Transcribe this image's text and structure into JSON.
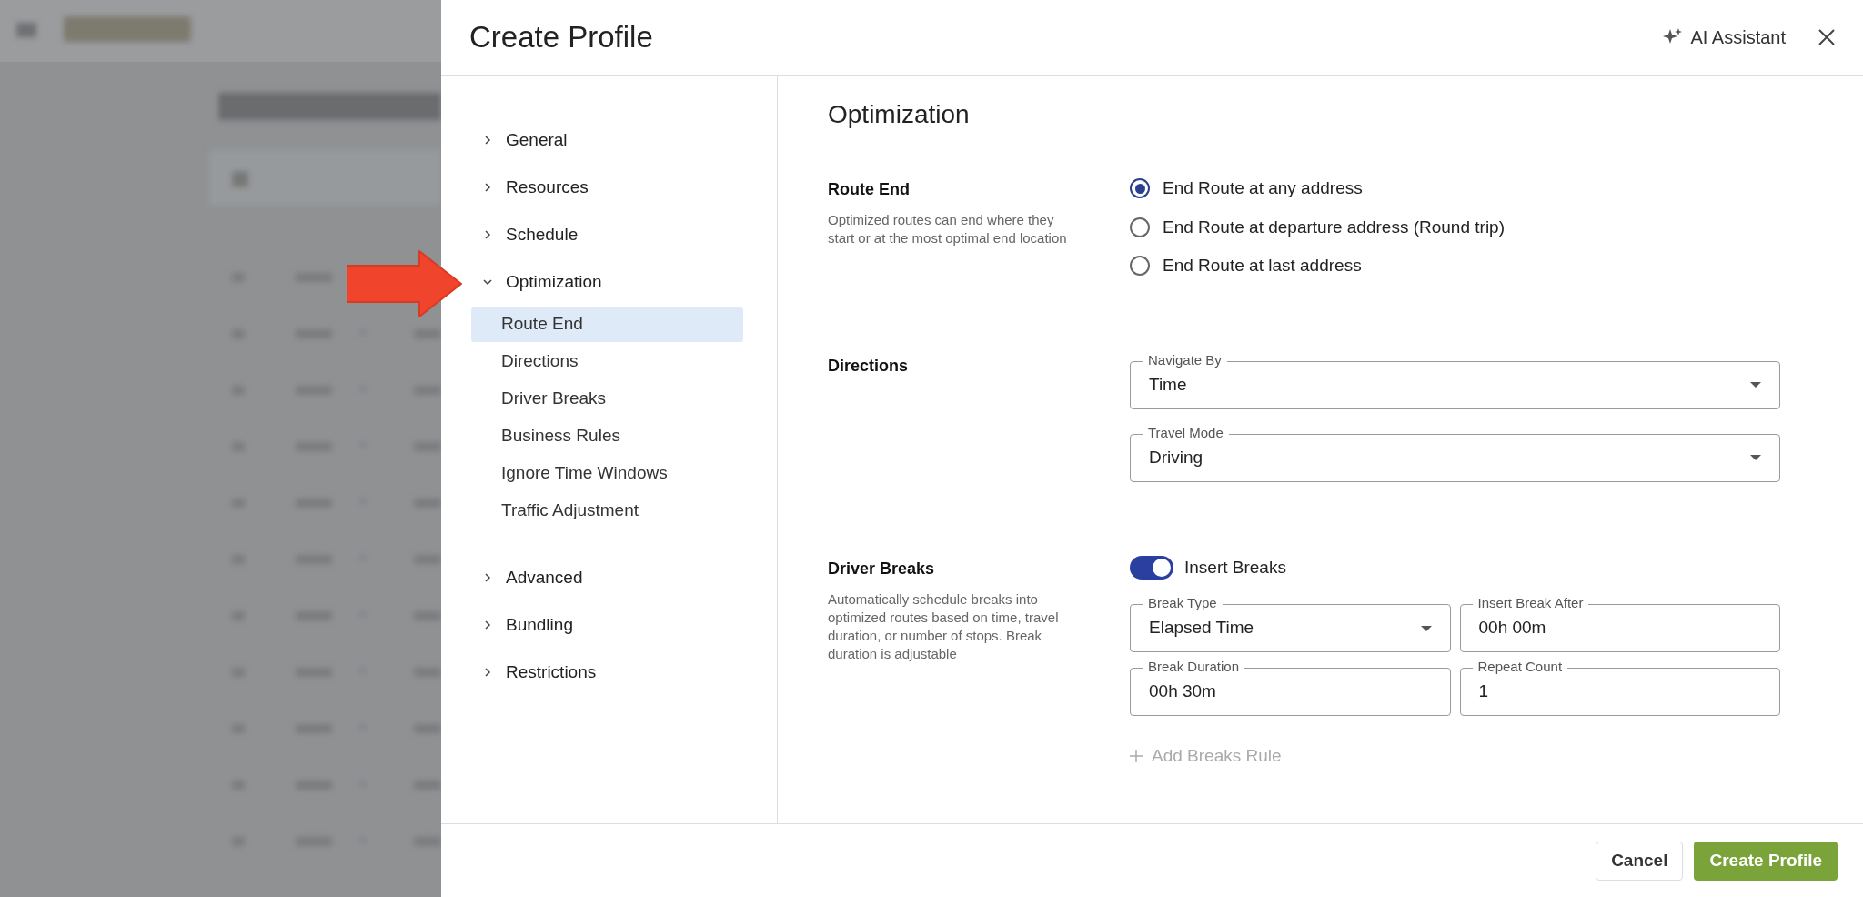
{
  "header": {
    "title": "Create Profile",
    "ai_button": "AI Assistant"
  },
  "sidebar": {
    "items": [
      {
        "label": "General",
        "expanded": false
      },
      {
        "label": "Resources",
        "expanded": false
      },
      {
        "label": "Schedule",
        "expanded": false
      },
      {
        "label": "Optimization",
        "expanded": true,
        "children": [
          {
            "label": "Route End",
            "selected": true
          },
          {
            "label": "Directions",
            "selected": false
          },
          {
            "label": "Driver Breaks",
            "selected": false
          },
          {
            "label": "Business Rules",
            "selected": false
          },
          {
            "label": "Ignore Time Windows",
            "selected": false
          },
          {
            "label": "Traffic Adjustment",
            "selected": false
          }
        ]
      },
      {
        "label": "Advanced",
        "expanded": false
      },
      {
        "label": "Bundling",
        "expanded": false
      },
      {
        "label": "Restrictions",
        "expanded": false
      }
    ]
  },
  "content": {
    "title": "Optimization",
    "sections": [
      {
        "kind": "radio",
        "title": "Route End",
        "description": "Optimized routes can end where they start or at the most optimal end location",
        "options": [
          {
            "label": "End Route at any address",
            "selected": true
          },
          {
            "label": "End Route at departure address (Round trip)",
            "selected": false
          },
          {
            "label": "End Route at last address",
            "selected": false
          }
        ]
      },
      {
        "kind": "selects",
        "title": "Directions",
        "fields": [
          {
            "label": "Navigate By",
            "value": "Time",
            "kind": "select"
          },
          {
            "label": "Travel Mode",
            "value": "Driving",
            "kind": "select"
          }
        ]
      },
      {
        "kind": "breaks",
        "title": "Driver Breaks",
        "description": "Automatically schedule breaks into optimized routes based on time, travel duration, or number of stops. Break duration is adjustable",
        "toggle": {
          "label": "Insert Breaks",
          "on": true
        },
        "fields": [
          {
            "label": "Break Type",
            "value": "Elapsed Time",
            "kind": "select"
          },
          {
            "label": "Insert Break After",
            "value": "00h 00m",
            "kind": "text"
          },
          {
            "label": "Break Duration",
            "value": "00h 30m",
            "kind": "text"
          },
          {
            "label": "Repeat Count",
            "value": "1",
            "kind": "text"
          }
        ],
        "add_button": {
          "label": "Add Breaks Rule",
          "disabled": true
        }
      }
    ]
  },
  "footer": {
    "cancel": "Cancel",
    "submit": "Create Profile"
  }
}
